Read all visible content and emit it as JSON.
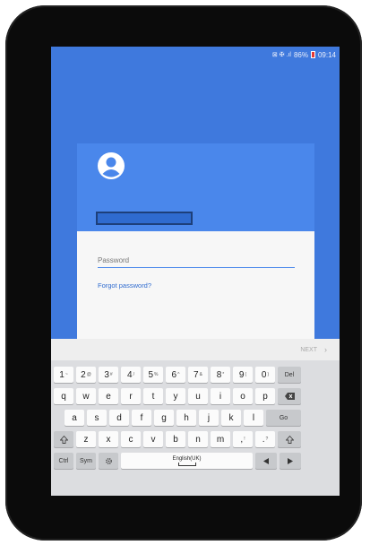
{
  "status": {
    "icons": "⊠ ✠ .ıl",
    "battery_percent": "86%",
    "time": "09:14"
  },
  "login": {
    "password_placeholder": "Password",
    "forgot_label": "Forgot password?"
  },
  "keyboard": {
    "next_label": "NEXT",
    "next_icon": "chevron-right-icon",
    "row1": [
      {
        "k": "1",
        "s": "~"
      },
      {
        "k": "2",
        "s": "@"
      },
      {
        "k": "3",
        "s": "#"
      },
      {
        "k": "4",
        "s": "/"
      },
      {
        "k": "5",
        "s": "%"
      },
      {
        "k": "6",
        "s": "^"
      },
      {
        "k": "7",
        "s": "&"
      },
      {
        "k": "8",
        "s": "*"
      },
      {
        "k": "9",
        "s": "("
      },
      {
        "k": "0",
        "s": ")"
      }
    ],
    "del_label": "Del",
    "row2": [
      "q",
      "w",
      "e",
      "r",
      "t",
      "y",
      "u",
      "i",
      "o",
      "p"
    ],
    "backspace_icon": "backspace-icon",
    "row3": [
      "a",
      "s",
      "d",
      "f",
      "g",
      "h",
      "j",
      "k",
      "l"
    ],
    "go_label": "Go",
    "row4": [
      "z",
      "x",
      "c",
      "v",
      "b",
      "n",
      "m"
    ],
    "comma_label": ",",
    "comma_sup": "!",
    "period_label": ".",
    "period_sup": "?",
    "shift_icon": "shift-icon",
    "ctrl_label": "Ctrl",
    "sym_label": "Sym",
    "settings_icon": "gear-icon",
    "language_label": "English(UK)",
    "left_icon": "left-arrow-icon",
    "right_icon": "right-arrow-icon"
  }
}
